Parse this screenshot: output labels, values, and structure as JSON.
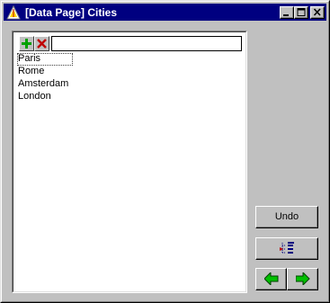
{
  "window": {
    "title": "[Data Page] Cities",
    "icon": "app-triangle-icon",
    "colors": {
      "titlebar": "#000080",
      "face": "#c0c0c0",
      "arrow_green": "#00c000",
      "remove_red": "#c00000"
    }
  },
  "toolbar": {
    "add_icon": "add-plus-icon",
    "remove_icon": "delete-x-icon",
    "input_value": ""
  },
  "list": {
    "items": [
      "Paris",
      "Rome",
      "Amsterdam",
      "London"
    ],
    "focused_index": 0
  },
  "buttons": {
    "undo_label": "Undo",
    "tree_icon": "tree-view-icon",
    "prev_icon": "arrow-left-icon",
    "next_icon": "arrow-right-icon"
  }
}
